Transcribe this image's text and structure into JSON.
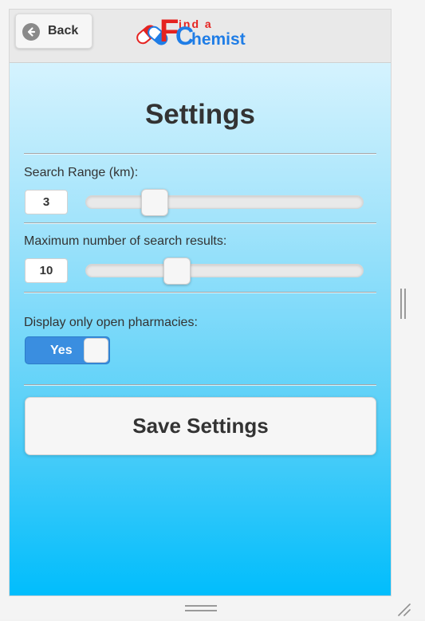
{
  "header": {
    "back_label": "Back",
    "logo": {
      "initial_top": "F",
      "initial_bottom": "C",
      "line1": "ind a",
      "line2": "hemist",
      "red": "#e52320",
      "blue": "#1f7de6"
    }
  },
  "page": {
    "title": "Settings"
  },
  "settings": {
    "search_range": {
      "label": "Search Range (km):",
      "value": "3",
      "slider_fraction": 0.22
    },
    "max_results": {
      "label": "Maximum number of search results:",
      "value": "10",
      "slider_fraction": 0.31
    },
    "open_only": {
      "label": "Display only open pharmacies:",
      "toggle_label": "Yes",
      "on": true
    }
  },
  "actions": {
    "save_label": "Save Settings"
  },
  "colors": {
    "accent": "#3a8ee0",
    "background_top": "#e6f8ff",
    "background_bottom": "#00bdfc"
  }
}
